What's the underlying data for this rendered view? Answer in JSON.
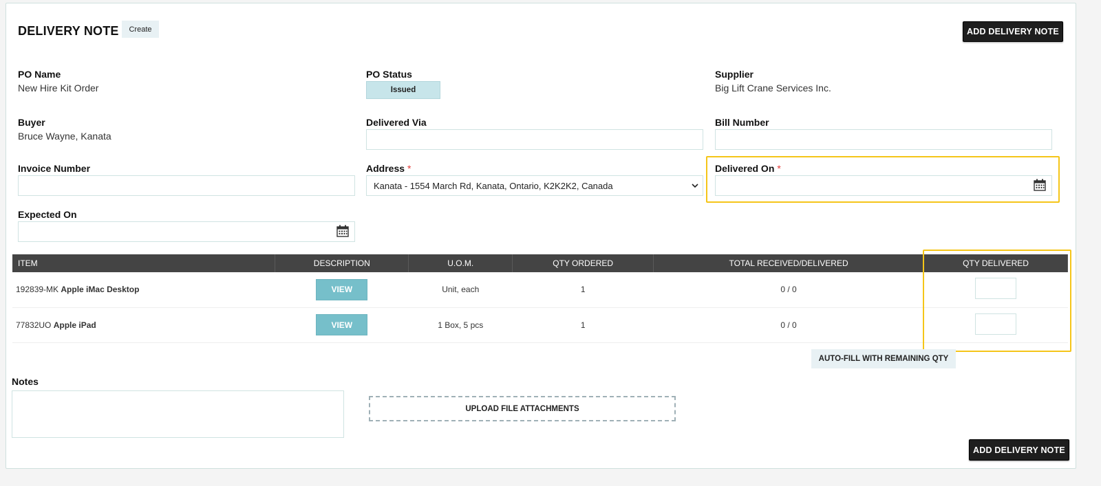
{
  "header": {
    "title": "DELIVERY NOTE",
    "mode_badge": "Create",
    "add_button_label": "ADD DELIVERY NOTE"
  },
  "po": {
    "name_label": "PO Name",
    "name_value": "New Hire Kit Order",
    "status_label": "PO Status",
    "status_value": "Issued",
    "supplier_label": "Supplier",
    "supplier_value": "Big Lift Crane Services Inc.",
    "buyer_label": "Buyer",
    "buyer_value": "Bruce Wayne, Kanata"
  },
  "form": {
    "delivered_via_label": "Delivered Via",
    "delivered_via_value": "",
    "bill_number_label": "Bill Number",
    "bill_number_value": "",
    "invoice_number_label": "Invoice Number",
    "invoice_number_value": "",
    "address_label": "Address",
    "address_value": "Kanata - 1554 March Rd, Kanata, Ontario, K2K2K2, Canada",
    "delivered_on_label": "Delivered On",
    "delivered_on_value": "",
    "expected_on_label": "Expected On",
    "expected_on_value": "",
    "required_mark": "*"
  },
  "table": {
    "columns": [
      "ITEM",
      "DESCRIPTION",
      "U.O.M.",
      "QTY ORDERED",
      "TOTAL RECEIVED/DELIVERED",
      "QTY DELIVERED"
    ],
    "view_label": "VIEW",
    "rows": [
      {
        "code": "192839-MK",
        "name": "Apple iMac Desktop",
        "uom": "Unit, each",
        "qty_ordered": "1",
        "received": "0 / 0",
        "qty_delivered": ""
      },
      {
        "code": "77832UO",
        "name": "Apple iPad",
        "uom": "1 Box, 5 pcs",
        "qty_ordered": "1",
        "received": "0 / 0",
        "qty_delivered": ""
      }
    ]
  },
  "autofill_label": "AUTO-FILL WITH REMAINING QTY",
  "notes_label": "Notes",
  "notes_value": "",
  "upload_label": "UPLOAD FILE ATTACHMENTS",
  "colors": {
    "highlight": "#f5c518",
    "header_bg": "#444444",
    "view_button": "#76bfca",
    "status_pill": "#c7e5ea",
    "required": "#e53935"
  }
}
